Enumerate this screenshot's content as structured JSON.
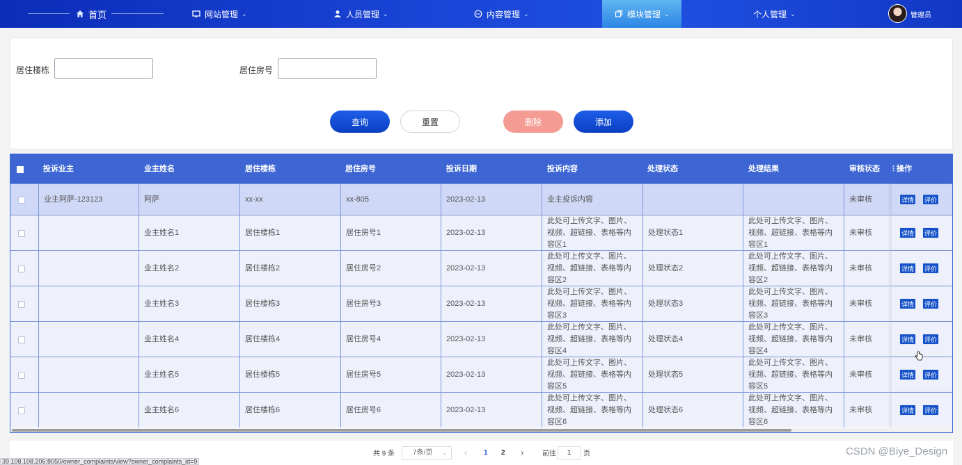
{
  "nav": {
    "home": "首页",
    "site": "网站管理",
    "people": "人员管理",
    "content": "内容管理",
    "module": "模块管理",
    "personal": "个人管理",
    "admin": "管理员"
  },
  "search": {
    "building_label": "居住楼栋",
    "room_label": "居住房号",
    "building_value": "",
    "room_value": "",
    "query_btn": "查询",
    "reset_btn": "重置",
    "delete_btn": "删除",
    "add_btn": "添加"
  },
  "table": {
    "headers": [
      "投诉业主",
      "业主姓名",
      "居住楼栋",
      "居住房号",
      "投诉日期",
      "投诉内容",
      "处理状态",
      "处理结果",
      "审核状态",
      "操作"
    ],
    "rows": [
      {
        "owner": "业主阿萨-123123",
        "name": "阿萨",
        "building": "xx-xx",
        "room": "xx-805",
        "date": "2023-02-13",
        "content": "业主投诉内容",
        "status": "",
        "result": "",
        "audit": "未审核"
      },
      {
        "owner": "",
        "name": "业主姓名1",
        "building": "居住楼栋1",
        "room": "居住房号1",
        "date": "2023-02-13",
        "content": "此处可上传文字、图片、视频、超链接、表格等内容区1",
        "status": "处理状态1",
        "result": "此处可上传文字、图片、视频、超链接、表格等内容区1",
        "audit": "未审核"
      },
      {
        "owner": "",
        "name": "业主姓名2",
        "building": "居住楼栋2",
        "room": "居住房号2",
        "date": "2023-02-13",
        "content": "此处可上传文字、图片、视频、超链接、表格等内容区2",
        "status": "处理状态2",
        "result": "此处可上传文字、图片、视频、超链接、表格等内容区2",
        "audit": "未审核"
      },
      {
        "owner": "",
        "name": "业主姓名3",
        "building": "居住楼栋3",
        "room": "居住房号3",
        "date": "2023-02-13",
        "content": "此处可上传文字、图片、视频、超链接、表格等内容区3",
        "status": "处理状态3",
        "result": "此处可上传文字、图片、视频、超链接、表格等内容区3",
        "audit": "未审核"
      },
      {
        "owner": "",
        "name": "业主姓名4",
        "building": "居住楼栋4",
        "room": "居住房号4",
        "date": "2023-02-13",
        "content": "此处可上传文字、图片、视频、超链接、表格等内容区4",
        "status": "处理状态4",
        "result": "此处可上传文字、图片、视频、超链接、表格等内容区4",
        "audit": "未审核"
      },
      {
        "owner": "",
        "name": "业主姓名5",
        "building": "居住楼栋5",
        "room": "居住房号5",
        "date": "2023-02-13",
        "content": "此处可上传文字、图片、视频、超链接、表格等内容区5",
        "status": "处理状态5",
        "result": "此处可上传文字、图片、视频、超链接、表格等内容区5",
        "audit": "未审核"
      },
      {
        "owner": "",
        "name": "业主姓名6",
        "building": "居住楼栋6",
        "room": "居住房号6",
        "date": "2023-02-13",
        "content": "此处可上传文字、图片、视频、超链接、表格等内容区6",
        "status": "处理状态6",
        "result": "此处可上传文字、图片、视频、超链接、表格等内容区6",
        "audit": "未审核"
      }
    ],
    "detail_btn": "详情",
    "review_btn": "评价"
  },
  "pager": {
    "total": "共 9 条",
    "page_size": "7条/页",
    "prev": "‹",
    "page1": "1",
    "page2": "2",
    "next": "›",
    "goto_label": "前往",
    "goto_value": "1",
    "page_unit": "页"
  },
  "status_url": "39.108.108.206:8050/owner_complaints/view?owner_complaints_id=9",
  "watermark": "CSDN @Biye_Design",
  "colors": {
    "nav": "#1a45d6",
    "primary": "#0a3fc2",
    "table_header": "#3d66d4",
    "delete": "#f49b93",
    "row_selected": "#cfd8f6"
  },
  "icons": [
    "home-icon",
    "monitor-icon",
    "user-icon",
    "chat-icon",
    "module-icon",
    "chevron-down-icon"
  ]
}
